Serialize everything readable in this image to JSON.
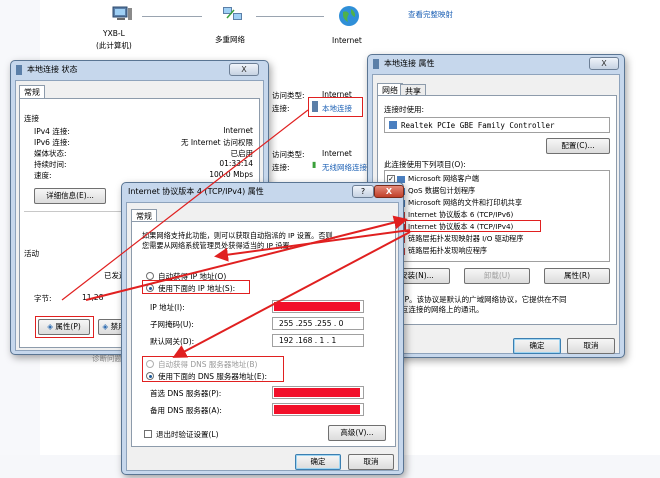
{
  "network_map": {
    "computer_name": "YXB-L",
    "computer_sub": "(此计算机)",
    "network_name": "多重网络",
    "internet_name": "Internet",
    "full_map_link": "查看完整映射"
  },
  "status_window": {
    "title": "本地连接 状态",
    "close": "X",
    "tab": "常规",
    "connection_section": "连接",
    "rows": [
      {
        "label": "IPv4 连接:",
        "value": "Internet"
      },
      {
        "label": "IPv6 连接:",
        "value": "无 Internet 访问权限"
      },
      {
        "label": "媒体状态:",
        "value": "已启用"
      },
      {
        "label": "持续时间:",
        "value": "01:33:14"
      },
      {
        "label": "速度:",
        "value": "100.0 Mbps"
      }
    ],
    "details_button": "详细信息(E)...",
    "activity_section": "活动",
    "sent_label": "已发送",
    "bytes_label": "字节:",
    "bytes_value": "11,28",
    "properties_button": "属性(P)",
    "disable_button": "禁用"
  },
  "background_info": {
    "access_type_label": "访问类型:",
    "access_type_value": "Internet",
    "connection_label": "连接:",
    "connection_value": "本地连接",
    "access_type2_label": "访问类型:",
    "access_type2_value": "Internet",
    "connection2_label": "连接:",
    "connection2_value": "无线网络连接",
    "bottom_partial": "诊断问题"
  },
  "properties_window": {
    "title": "本地连接 属性",
    "close": "X",
    "tabs": [
      "网络",
      "共享"
    ],
    "connect_using_label": "连接时使用:",
    "adapter": "Realtek PCIe GBE Family Controller",
    "configure_button": "配置(C)...",
    "items_label": "此连接使用下列项目(O):",
    "items": [
      {
        "label": "Microsoft 网络客户端",
        "checked": true
      },
      {
        "label": "QoS 数据包计划程序",
        "checked": true
      },
      {
        "label": "Microsoft 网络的文件和打印机共享",
        "checked": true
      },
      {
        "label": "Internet 协议版本 6 (TCP/IPv6)",
        "checked": true
      },
      {
        "label": "Internet 协议版本 4 (TCP/IPv4)",
        "checked": true
      },
      {
        "label": "链路层拓扑发现映射器 I/O 驱动程序",
        "checked": true
      },
      {
        "label": "链路层拓扑发现响应程序",
        "checked": true
      }
    ],
    "install_button": "安装(N)...",
    "uninstall_button": "卸载(U)",
    "properties_button": "属性(R)",
    "description_text": "TCP/IP。该协议是默认的广域网络协议，它提供在不同",
    "description_text2": "的相互连接的网络上的通讯。",
    "ok_button": "确定",
    "cancel_button": "取消"
  },
  "ipv4_window": {
    "title": "Internet 协议版本 4 (TCP/IPv4) 属性",
    "help": "?",
    "close": "X",
    "tab": "常规",
    "intro_line1": "如果网络支持此功能，则可以获取自动指派的 IP 设置。否则，",
    "intro_line2": "您需要从网络系统管理员处获得适当的 IP 设置。",
    "auto_ip": "自动获得 IP 地址(O)",
    "manual_ip": "使用下面的 IP 地址(S):",
    "ip_label": "IP 地址(I):",
    "mask_label": "子网掩码(U):",
    "mask_value": "255 .255 .255 . 0",
    "gateway_label": "默认网关(D):",
    "gateway_value": "192 .168 . 1 . 1",
    "auto_dns": "自动获得 DNS 服务器地址(B)",
    "manual_dns": "使用下面的 DNS 服务器地址(E):",
    "dns1_label": "首选 DNS 服务器(P):",
    "dns2_label": "备用 DNS 服务器(A):",
    "validate_label": "退出时验证设置(L)",
    "advanced_button": "高级(V)...",
    "ok_button": "确定",
    "cancel_button": "取消"
  },
  "colors": {
    "annotation_red": "#e02020",
    "redacted_fill": "#f2102a",
    "window_frame": "#c6d7ec"
  }
}
